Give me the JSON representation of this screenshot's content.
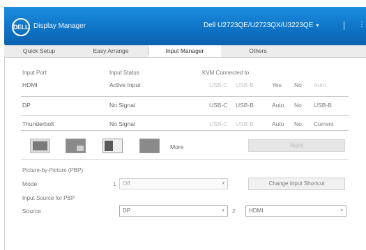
{
  "header": {
    "logo_text": "DELL",
    "app_title": "Display Manager",
    "monitor_selector": "Dell U2723QE/U2723QX/U3223QE",
    "icon_right": "info-icon"
  },
  "tabs": [
    {
      "label": "Quick Setup",
      "active": false
    },
    {
      "label": "Easy Arrange",
      "active": false
    },
    {
      "label": "Input Manager",
      "active": true
    },
    {
      "label": "Others",
      "active": false
    }
  ],
  "table": {
    "headers": [
      "Input Port",
      "Input Status",
      "KVM Connected to"
    ],
    "rows": [
      {
        "port": "HDMI",
        "status": "Active Input",
        "options": [
          "USB-C",
          "USB-B",
          "Yes",
          "No",
          "Auto"
        ],
        "dim": [
          true,
          true,
          false,
          false,
          true
        ]
      },
      {
        "port": "DP",
        "status": "No Signal",
        "options": [
          "USB-C",
          "USB-B",
          "Auto",
          "No",
          "USB-B"
        ],
        "dim": [
          false,
          false,
          false,
          false,
          false
        ]
      },
      {
        "port": "Thunderbolt",
        "status": "No Signal",
        "options": [
          "USB-C",
          "USB-B",
          "Auto",
          "No",
          "Current"
        ],
        "dim": [
          true,
          true,
          false,
          false,
          false
        ]
      }
    ]
  },
  "layouts": {
    "more_label": "More",
    "apply_button": "Apply"
  },
  "pbp": {
    "section_title": "Picture-by-Picture (PBP)",
    "field_label": "Mode",
    "number_label": "1",
    "select_value": "Off",
    "button_label": "Change Input Shortcut"
  },
  "sources": {
    "section_title": "Input Source for PBP",
    "field_label": "Source",
    "select_a_value": "DP",
    "number_label_b": "2",
    "select_b_value": "HDMI"
  },
  "colors": {
    "header_top": "#1e8ee0",
    "header_bottom": "#0a62b0",
    "tab_bar": "#ececec"
  }
}
